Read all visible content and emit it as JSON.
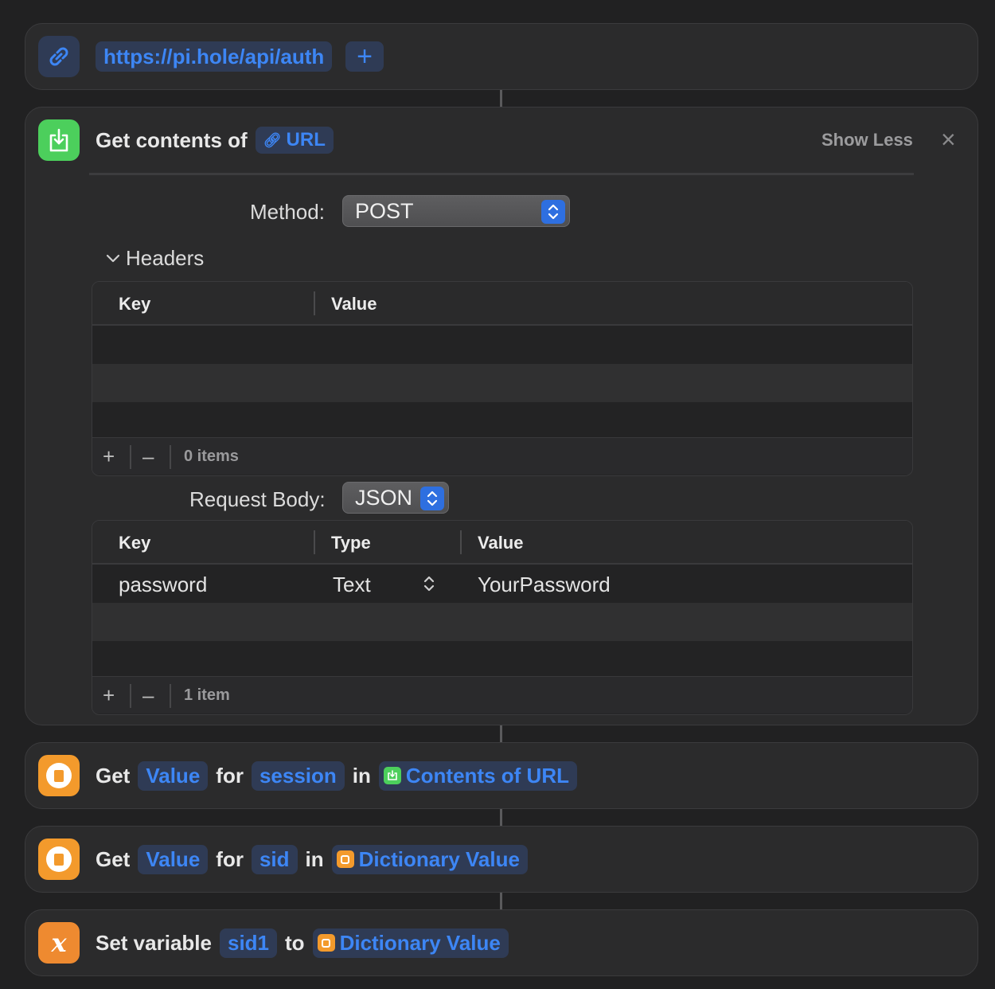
{
  "url_action": {
    "url": "https://pi.hole/api/auth",
    "add_label": "+"
  },
  "get_contents": {
    "title": "Get contents of",
    "url_token": "URL",
    "show_less": "Show Less",
    "close": "×",
    "method_label": "Method:",
    "method_value": "POST",
    "headers_label": "Headers",
    "headers_table": {
      "col_key": "Key",
      "col_value": "Value",
      "count": "0 items"
    },
    "request_body_label": "Request Body:",
    "request_body_value": "JSON",
    "body_table": {
      "col_key": "Key",
      "col_type": "Type",
      "col_value": "Value",
      "rows": [
        {
          "key": "password",
          "type": "Text",
          "value": "YourPassword"
        }
      ],
      "count": "1 item"
    }
  },
  "get_value_1": {
    "verb": "Get",
    "token_value": "Value",
    "for": "for",
    "token_key": "session",
    "in": "in",
    "token_source": "Contents of URL"
  },
  "get_value_2": {
    "verb": "Get",
    "token_value": "Value",
    "for": "for",
    "token_key": "sid",
    "in": "in",
    "token_source": "Dictionary Value"
  },
  "set_variable": {
    "verb": "Set variable",
    "token_name": "sid1",
    "to": "to",
    "token_source": "Dictionary Value"
  },
  "colors": {
    "accent": "#3d86f5",
    "green_icon": "#4ccf5c",
    "orange_icon": "#f39a2c"
  }
}
